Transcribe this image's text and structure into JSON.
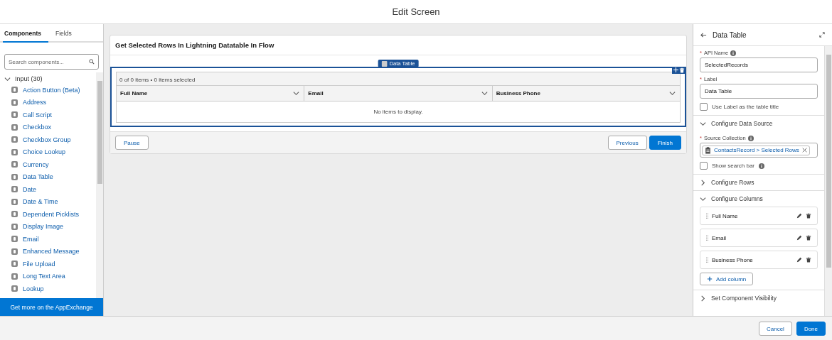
{
  "header": {
    "title": "Edit Screen"
  },
  "left_panel": {
    "tabs": [
      {
        "label": "Components",
        "selected": true
      },
      {
        "label": "Fields",
        "selected": false
      }
    ],
    "search": {
      "placeholder": "Search components..."
    },
    "group": {
      "label": "Input (30)",
      "expanded": true,
      "items": [
        {
          "label": "Action Button (Beta)"
        },
        {
          "label": "Address"
        },
        {
          "label": "Call Script"
        },
        {
          "label": "Checkbox"
        },
        {
          "label": "Checkbox Group"
        },
        {
          "label": "Choice Lookup"
        },
        {
          "label": "Currency"
        },
        {
          "label": "Data Table"
        },
        {
          "label": "Date"
        },
        {
          "label": "Date & Time"
        },
        {
          "label": "Dependent Picklists"
        },
        {
          "label": "Display Image"
        },
        {
          "label": "Email"
        },
        {
          "label": "Enhanced Message"
        },
        {
          "label": "File Upload"
        },
        {
          "label": "Long Text Area"
        },
        {
          "label": "Lookup"
        }
      ]
    },
    "footer_button": "Get more on the AppExchange"
  },
  "canvas": {
    "screen_title": "Get Selected Rows In Lightning Datatable In Flow",
    "component_tag": "Data Table",
    "table": {
      "summary": "0 of 0 items • 0 items selected",
      "columns": [
        "Full Name",
        "Email",
        "Business Phone"
      ],
      "empty_message": "No items to display."
    },
    "pause_button": "Pause",
    "previous_button": "Previous",
    "finish_button": "Finish"
  },
  "properties": {
    "title": "Data Table",
    "api_name": {
      "marker": "*",
      "label": "API Name",
      "value": "SelectedRecords"
    },
    "label_field": {
      "marker": "*",
      "label": "Label",
      "value": "Data Table"
    },
    "use_label_checkbox": {
      "label": "Use Label as the table title",
      "checked": false
    },
    "sections": [
      {
        "kind": "source",
        "title": "Configure Data Source",
        "expanded": true,
        "marker": "*",
        "field_label": "Source Collection",
        "pill": "ContactsRecord > Selected Rows",
        "checkbox": {
          "label": "Show search bar",
          "checked": false
        }
      },
      {
        "title": "Configure Rows",
        "expanded": false
      },
      {
        "kind": "columns",
        "title": "Configure Columns",
        "expanded": true,
        "columns": [
          "Full Name",
          "Email",
          "Business Phone"
        ],
        "add_button": "Add column"
      },
      {
        "title": "Set Component Visibility",
        "expanded": false
      }
    ]
  },
  "footer": {
    "cancel_button": "Cancel",
    "done_button": "Done"
  }
}
